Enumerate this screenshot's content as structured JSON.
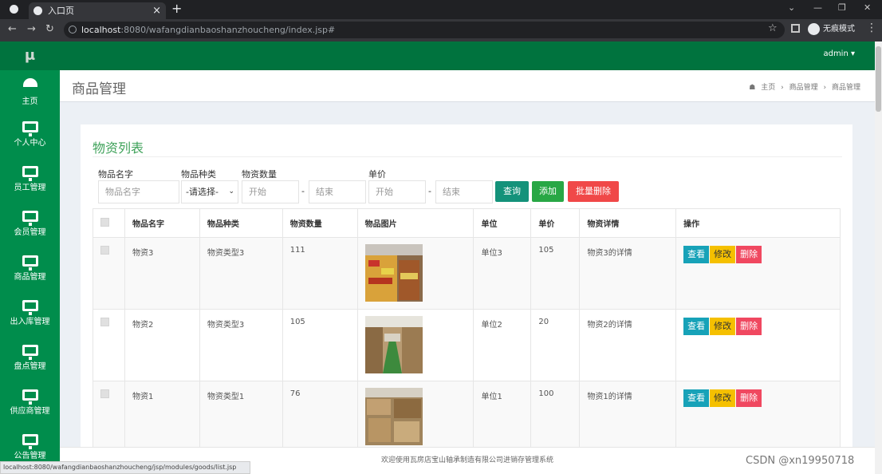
{
  "browser": {
    "tab_title": "入口页",
    "url_host": "localhost",
    "url_rest": ":8080/wafangdianbaoshanzhoucheng/index.jsp#",
    "incognito_label": "无痕模式"
  },
  "header": {
    "user": "admin ▾"
  },
  "sidebar": {
    "logo": "μ",
    "items": [
      {
        "label": "主页",
        "icon": "dashboard-icon"
      },
      {
        "label": "个人中心",
        "icon": "monitor-icon"
      },
      {
        "label": "员工管理",
        "icon": "monitor-icon"
      },
      {
        "label": "会员管理",
        "icon": "monitor-icon"
      },
      {
        "label": "商品管理",
        "icon": "monitor-icon"
      },
      {
        "label": "出入库管理",
        "icon": "monitor-icon"
      },
      {
        "label": "盘点管理",
        "icon": "monitor-icon"
      },
      {
        "label": "供应商管理",
        "icon": "monitor-icon"
      },
      {
        "label": "公告管理",
        "icon": "monitor-icon"
      }
    ]
  },
  "page": {
    "title": "商品管理",
    "breadcrumb": [
      "主页",
      "商品管理",
      "商品管理"
    ],
    "panel_title": "物资列表"
  },
  "filters": {
    "name_label": "物品名字",
    "name_placeholder": "物品名字",
    "type_label": "物品种类",
    "type_selected": "-请选择-",
    "qty_label": "物资数量",
    "qty_start": "开始",
    "qty_end": "结束",
    "price_label": "单价",
    "price_start": "开始",
    "price_end": "结束",
    "sep": "-"
  },
  "buttons": {
    "query": "查询",
    "add": "添加",
    "batch_delete": "批量删除"
  },
  "table": {
    "headers": [
      "物品名字",
      "物品种类",
      "物资数量",
      "物品图片",
      "单位",
      "单价",
      "物资详情",
      "操作"
    ],
    "rows": [
      {
        "name": "物资3",
        "type": "物资类型3",
        "qty": "111",
        "unit": "单位3",
        "price": "105",
        "detail": "物资3的详情"
      },
      {
        "name": "物资2",
        "type": "物资类型3",
        "qty": "105",
        "unit": "单位2",
        "price": "20",
        "detail": "物资2的详情"
      },
      {
        "name": "物资1",
        "type": "物资类型1",
        "qty": "76",
        "unit": "单位1",
        "price": "100",
        "detail": "物资1的详情"
      }
    ],
    "actions": {
      "view": "查看",
      "edit": "修改",
      "delete": "删除"
    }
  },
  "footer": {
    "text": "欢迎使用瓦房店宝山轴承制造有限公司进销存管理系统"
  },
  "status_url": "localhost:8080/wafangdianbaoshanzhoucheng/jsp/modules/goods/list.jsp",
  "watermark": "CSDN @xn19950718",
  "colors": {
    "sidebar": "#008d4c",
    "topbar": "#00733e",
    "accent_title": "#3fa25a"
  }
}
